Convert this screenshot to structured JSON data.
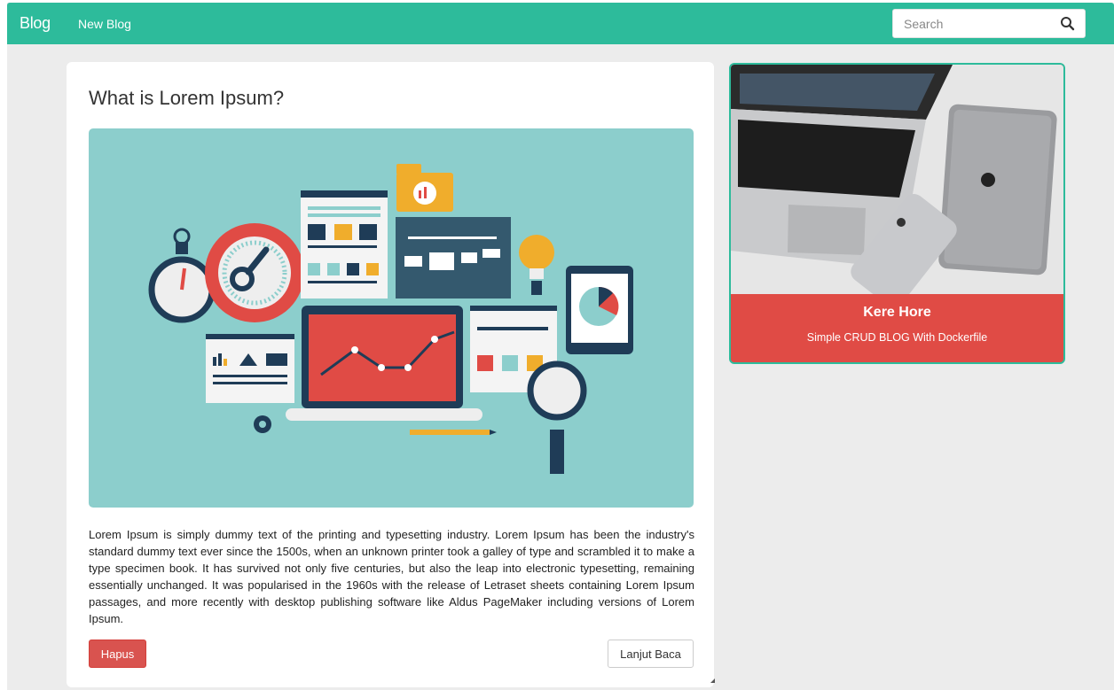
{
  "navbar": {
    "brand": "Blog",
    "new_blog": "New Blog",
    "search": {
      "placeholder": "Search",
      "value": ""
    },
    "color": "#2dbb9b"
  },
  "post": {
    "title": "What is Lorem Ipsum?",
    "image_icon": "data-analytics-illustration",
    "body": "Lorem Ipsum is simply dummy text of the printing and typesetting industry. Lorem Ipsum has been the industry's standard dummy text ever since the 1500s, when an unknown printer took a galley of type and scrambled it to make a type specimen book. It has survived not only five centuries, but also the leap into electronic typesetting, remaining essentially unchanged. It was popularised in the 1960s with the release of Letraset sheets containing Lorem Ipsum passages, and more recently with desktop publishing software like Aldus PageMaker including versions of Lorem Ipsum.",
    "delete_label": "Hapus",
    "read_more_label": "Lanjut Baca"
  },
  "sidebar_card": {
    "image_icon": "laptop-tablet-phone-photo",
    "title": "Kere Hore",
    "subtitle": "Simple CRUD BLOG With Dockerfile",
    "accent": "#e04b45"
  }
}
